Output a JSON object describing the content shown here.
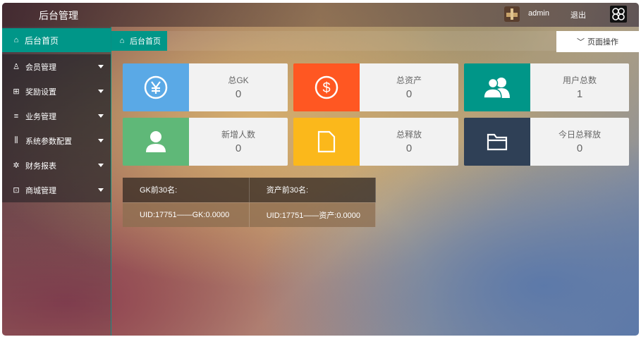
{
  "header": {
    "title": "后台管理",
    "username": "admin",
    "logout_label": "退出"
  },
  "sidebar": {
    "home_label": "后台首页",
    "items": [
      {
        "label": "会员管理",
        "icon": "user-icon"
      },
      {
        "label": "奖励设置",
        "icon": "gift-icon"
      },
      {
        "label": "业务管理",
        "icon": "list-icon"
      },
      {
        "label": "系统参数配置",
        "icon": "sliders-icon"
      },
      {
        "label": "财务报表",
        "icon": "chart-icon"
      },
      {
        "label": "商城管理",
        "icon": "shop-icon"
      }
    ]
  },
  "tabs": {
    "active_label": "后台首页",
    "page_op_label": "页面操作"
  },
  "stats": [
    {
      "label": "总GK",
      "value": "0",
      "color": "#5aa9e6",
      "icon": "yen-icon"
    },
    {
      "label": "总资产",
      "value": "0",
      "color": "#ff5722",
      "icon": "dollar-icon"
    },
    {
      "label": "用户总数",
      "value": "1",
      "color": "#009688",
      "icon": "users-icon"
    },
    {
      "label": "新增人数",
      "value": "0",
      "color": "#5fb878",
      "icon": "user-add-icon"
    },
    {
      "label": "总释放",
      "value": "0",
      "color": "#fbb81b",
      "icon": "file-icon"
    },
    {
      "label": "今日总释放",
      "value": "0",
      "color": "#2f4056",
      "icon": "folder-icon"
    }
  ],
  "rank_table": {
    "headers": [
      "GK前30名:",
      "资产前30名:"
    ],
    "rows": [
      [
        "UID:17751——GK:0.0000",
        "UID:17751——资产:0.0000"
      ]
    ]
  }
}
